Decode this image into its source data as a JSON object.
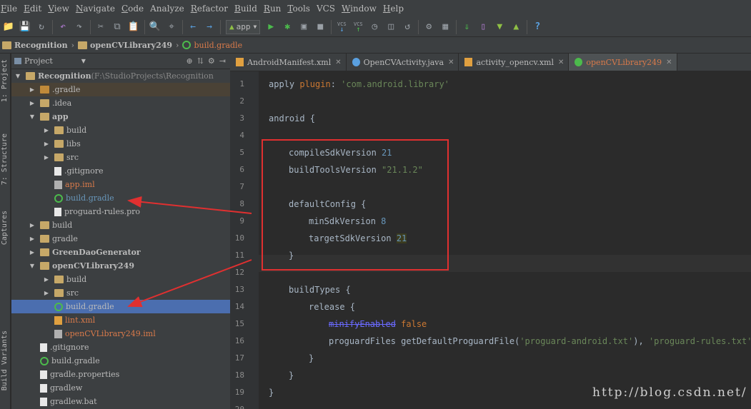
{
  "menu": [
    {
      "u": "F",
      "rest": "ile"
    },
    {
      "u": "E",
      "rest": "dit"
    },
    {
      "u": "V",
      "rest": "iew"
    },
    {
      "u": "N",
      "rest": "avigate"
    },
    {
      "u": "C",
      "rest": "ode"
    },
    {
      "u": "",
      "rest": "Analyze"
    },
    {
      "u": "R",
      "rest": "efactor"
    },
    {
      "u": "B",
      "rest": "uild"
    },
    {
      "u": "R",
      "rest": "un"
    },
    {
      "u": "T",
      "rest": "ools"
    },
    {
      "u": "",
      "rest": "VCS"
    },
    {
      "u": "W",
      "rest": "indow"
    },
    {
      "u": "H",
      "rest": "elp"
    }
  ],
  "toolbar": {
    "run_config": "app",
    "vcs_label": "VCS"
  },
  "breadcrumb": [
    "Recognition",
    "openCVLibrary249",
    "build.gradle"
  ],
  "side_tabs": {
    "project": "1: Project",
    "structure": "7: Structure",
    "captures": "Captures",
    "build_variants": "Build Variants"
  },
  "project_panel": {
    "title": "Project"
  },
  "tree": [
    {
      "depth": 0,
      "arrow": "down",
      "icon": "folder",
      "label": "Recognition",
      "extra": " (F:\\StudioProjects\\Recognition",
      "style": "bold"
    },
    {
      "depth": 1,
      "arrow": "right",
      "icon": "folder-orange",
      "label": ".gradle",
      "style": "normal",
      "hl": true
    },
    {
      "depth": 1,
      "arrow": "right",
      "icon": "folder",
      "label": ".idea",
      "style": "normal"
    },
    {
      "depth": 1,
      "arrow": "down",
      "icon": "folder",
      "label": "app",
      "style": "bold"
    },
    {
      "depth": 2,
      "arrow": "right",
      "icon": "folder",
      "label": "build",
      "style": "normal"
    },
    {
      "depth": 2,
      "arrow": "right",
      "icon": "folder",
      "label": "libs",
      "style": "normal"
    },
    {
      "depth": 2,
      "arrow": "right",
      "icon": "folder",
      "label": "src",
      "style": "normal"
    },
    {
      "depth": 2,
      "arrow": "",
      "icon": "file",
      "label": ".gitignore",
      "style": "normal"
    },
    {
      "depth": 2,
      "arrow": "",
      "icon": "iml",
      "label": "app.iml",
      "style": "orange"
    },
    {
      "depth": 2,
      "arrow": "",
      "icon": "gradle",
      "label": "build.gradle",
      "style": "blue"
    },
    {
      "depth": 2,
      "arrow": "",
      "icon": "file",
      "label": "proguard-rules.pro",
      "style": "normal"
    },
    {
      "depth": 1,
      "arrow": "right",
      "icon": "folder",
      "label": "build",
      "style": "normal"
    },
    {
      "depth": 1,
      "arrow": "right",
      "icon": "folder",
      "label": "gradle",
      "style": "normal"
    },
    {
      "depth": 1,
      "arrow": "right",
      "icon": "folder",
      "label": "GreenDaoGenerator",
      "style": "bold"
    },
    {
      "depth": 1,
      "arrow": "down",
      "icon": "folder",
      "label": "openCVLibrary249",
      "style": "bold"
    },
    {
      "depth": 2,
      "arrow": "right",
      "icon": "folder",
      "label": "build",
      "style": "normal"
    },
    {
      "depth": 2,
      "arrow": "right",
      "icon": "folder",
      "label": "src",
      "style": "normal"
    },
    {
      "depth": 2,
      "arrow": "",
      "icon": "gradle",
      "label": "build.gradle",
      "style": "normal",
      "sel": true
    },
    {
      "depth": 2,
      "arrow": "",
      "icon": "xml",
      "label": "lint.xml",
      "style": "orange"
    },
    {
      "depth": 2,
      "arrow": "",
      "icon": "iml",
      "label": "openCVLibrary249.iml",
      "style": "orange"
    },
    {
      "depth": 1,
      "arrow": "",
      "icon": "file",
      "label": ".gitignore",
      "style": "normal"
    },
    {
      "depth": 1,
      "arrow": "",
      "icon": "gradle",
      "label": "build.gradle",
      "style": "normal"
    },
    {
      "depth": 1,
      "arrow": "",
      "icon": "file",
      "label": "gradle.properties",
      "style": "normal"
    },
    {
      "depth": 1,
      "arrow": "",
      "icon": "file",
      "label": "gradlew",
      "style": "normal"
    },
    {
      "depth": 1,
      "arrow": "",
      "icon": "file",
      "label": "gradlew.bat",
      "style": "normal"
    }
  ],
  "tabs": [
    {
      "label": "AndroidManifest.xml",
      "icon": "xml",
      "active": false
    },
    {
      "label": "OpenCVActivity.java",
      "icon": "java",
      "active": false
    },
    {
      "label": "activity_opencv.xml",
      "icon": "xml",
      "active": false
    },
    {
      "label": "openCVLibrary249",
      "icon": "gradle",
      "active": true
    }
  ],
  "code_lines": [
    {
      "n": "1",
      "indent": 0,
      "parts": [
        [
          "p",
          "apply "
        ],
        [
          "kw",
          "plugin"
        ],
        [
          "p",
          ": "
        ],
        [
          "str",
          "'com.android.library'"
        ]
      ]
    },
    {
      "n": "2",
      "indent": 0,
      "parts": []
    },
    {
      "n": "3",
      "indent": 0,
      "parts": [
        [
          "p",
          "android {"
        ]
      ]
    },
    {
      "n": "4",
      "indent": 0,
      "parts": []
    },
    {
      "n": "5",
      "indent": 1,
      "parts": [
        [
          "p",
          "compileSdkVersion "
        ],
        [
          "num",
          "21"
        ]
      ]
    },
    {
      "n": "6",
      "indent": 1,
      "parts": [
        [
          "p",
          "buildToolsVersion "
        ],
        [
          "str",
          "\"21.1.2\""
        ]
      ]
    },
    {
      "n": "7",
      "indent": 0,
      "parts": []
    },
    {
      "n": "8",
      "indent": 1,
      "parts": [
        [
          "p",
          "defaultConfig {"
        ]
      ]
    },
    {
      "n": "9",
      "indent": 2,
      "parts": [
        [
          "p",
          "minSdkVersion "
        ],
        [
          "num",
          "8"
        ]
      ]
    },
    {
      "n": "10",
      "indent": 2,
      "parts": [
        [
          "p",
          "targetSdkVersion "
        ],
        [
          "num",
          "21"
        ]
      ]
    },
    {
      "n": "11",
      "indent": 1,
      "parts": [
        [
          "p",
          "}"
        ]
      ]
    },
    {
      "n": "12",
      "indent": 0,
      "parts": []
    },
    {
      "n": "13",
      "indent": 1,
      "parts": [
        [
          "p",
          "buildTypes {"
        ]
      ]
    },
    {
      "n": "14",
      "indent": 2,
      "parts": [
        [
          "p",
          "release {"
        ]
      ]
    },
    {
      "n": "15",
      "indent": 3,
      "parts": [
        [
          "dep",
          "minifyEnabled"
        ],
        [
          "kw",
          " false"
        ]
      ]
    },
    {
      "n": "16",
      "indent": 3,
      "parts": [
        [
          "p",
          "proguardFiles getDefaultProguardFile("
        ],
        [
          "str",
          "'proguard-android.txt'"
        ],
        [
          "p",
          "), "
        ],
        [
          "str",
          "'proguard-rules.txt'"
        ]
      ]
    },
    {
      "n": "17",
      "indent": 2,
      "parts": [
        [
          "p",
          "}"
        ]
      ]
    },
    {
      "n": "18",
      "indent": 1,
      "parts": [
        [
          "p",
          "}"
        ]
      ]
    },
    {
      "n": "19",
      "indent": 0,
      "parts": [
        [
          "p",
          "}"
        ]
      ]
    },
    {
      "n": "20",
      "indent": 0,
      "parts": []
    }
  ],
  "watermark": "http://blog.csdn.net/",
  "colors": {
    "accent_red": "#e03030",
    "selection": "#4b6eaf",
    "keyword": "#cc7832",
    "string": "#6a8759",
    "number": "#6897bb"
  }
}
